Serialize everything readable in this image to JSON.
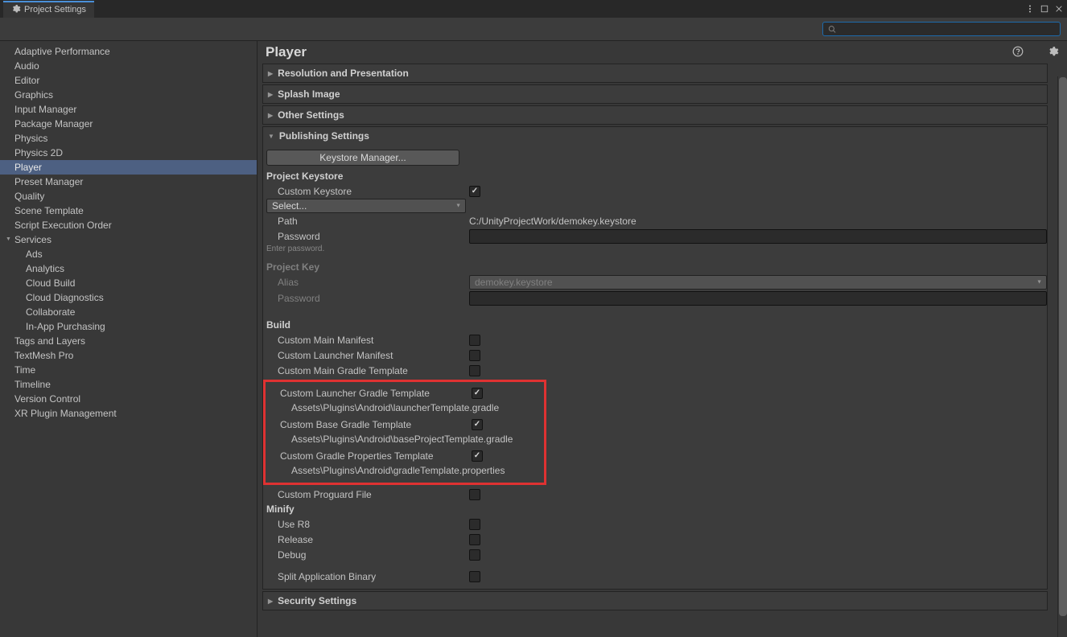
{
  "window": {
    "title": "Project Settings"
  },
  "search": {
    "placeholder": "",
    "icon_glyph": ""
  },
  "sidebar": {
    "items": [
      {
        "label": "Adaptive Performance"
      },
      {
        "label": "Audio"
      },
      {
        "label": "Editor"
      },
      {
        "label": "Graphics"
      },
      {
        "label": "Input Manager"
      },
      {
        "label": "Package Manager"
      },
      {
        "label": "Physics"
      },
      {
        "label": "Physics 2D"
      },
      {
        "label": "Player",
        "selected": true
      },
      {
        "label": "Preset Manager"
      },
      {
        "label": "Quality"
      },
      {
        "label": "Scene Template"
      },
      {
        "label": "Script Execution Order"
      },
      {
        "label": "Services",
        "expandable": true,
        "children": [
          {
            "label": "Ads"
          },
          {
            "label": "Analytics"
          },
          {
            "label": "Cloud Build"
          },
          {
            "label": "Cloud Diagnostics"
          },
          {
            "label": "Collaborate"
          },
          {
            "label": "In-App Purchasing"
          }
        ]
      },
      {
        "label": "Tags and Layers"
      },
      {
        "label": "TextMesh Pro"
      },
      {
        "label": "Time"
      },
      {
        "label": "Timeline"
      },
      {
        "label": "Version Control"
      },
      {
        "label": "XR Plugin Management"
      }
    ]
  },
  "content": {
    "title": "Player",
    "foldouts": {
      "resolution": "Resolution and Presentation",
      "splash": "Splash Image",
      "other": "Other Settings",
      "publishing": "Publishing Settings",
      "security": "Security Settings"
    },
    "publishing": {
      "keystore_manager_btn": "Keystore Manager...",
      "project_keystore_label": "Project Keystore",
      "custom_keystore_label": "Custom Keystore",
      "select_dropdown": "Select...",
      "path_label": "Path",
      "path_value": "C:/UnityProjectWork/demokey.keystore",
      "password_label": "Password",
      "password_hint": "Enter password.",
      "project_key_label": "Project Key",
      "alias_label": "Alias",
      "alias_value": "demokey.keystore",
      "key_password_label": "Password",
      "build_label": "Build",
      "custom_main_manifest": "Custom Main Manifest",
      "custom_launcher_manifest": "Custom Launcher Manifest",
      "custom_main_gradle": "Custom Main Gradle Template",
      "custom_launcher_gradle": "Custom Launcher Gradle Template",
      "launcher_gradle_path": "Assets\\Plugins\\Android\\launcherTemplate.gradle",
      "custom_base_gradle": "Custom Base Gradle Template",
      "base_gradle_path": "Assets\\Plugins\\Android\\baseProjectTemplate.gradle",
      "custom_gradle_props": "Custom Gradle Properties Template",
      "gradle_props_path": "Assets\\Plugins\\Android\\gradleTemplate.properties",
      "custom_proguard": "Custom Proguard File",
      "minify_label": "Minify",
      "use_r8": "Use R8",
      "release": "Release",
      "debug": "Debug",
      "split_app_binary": "Split Application Binary"
    }
  }
}
